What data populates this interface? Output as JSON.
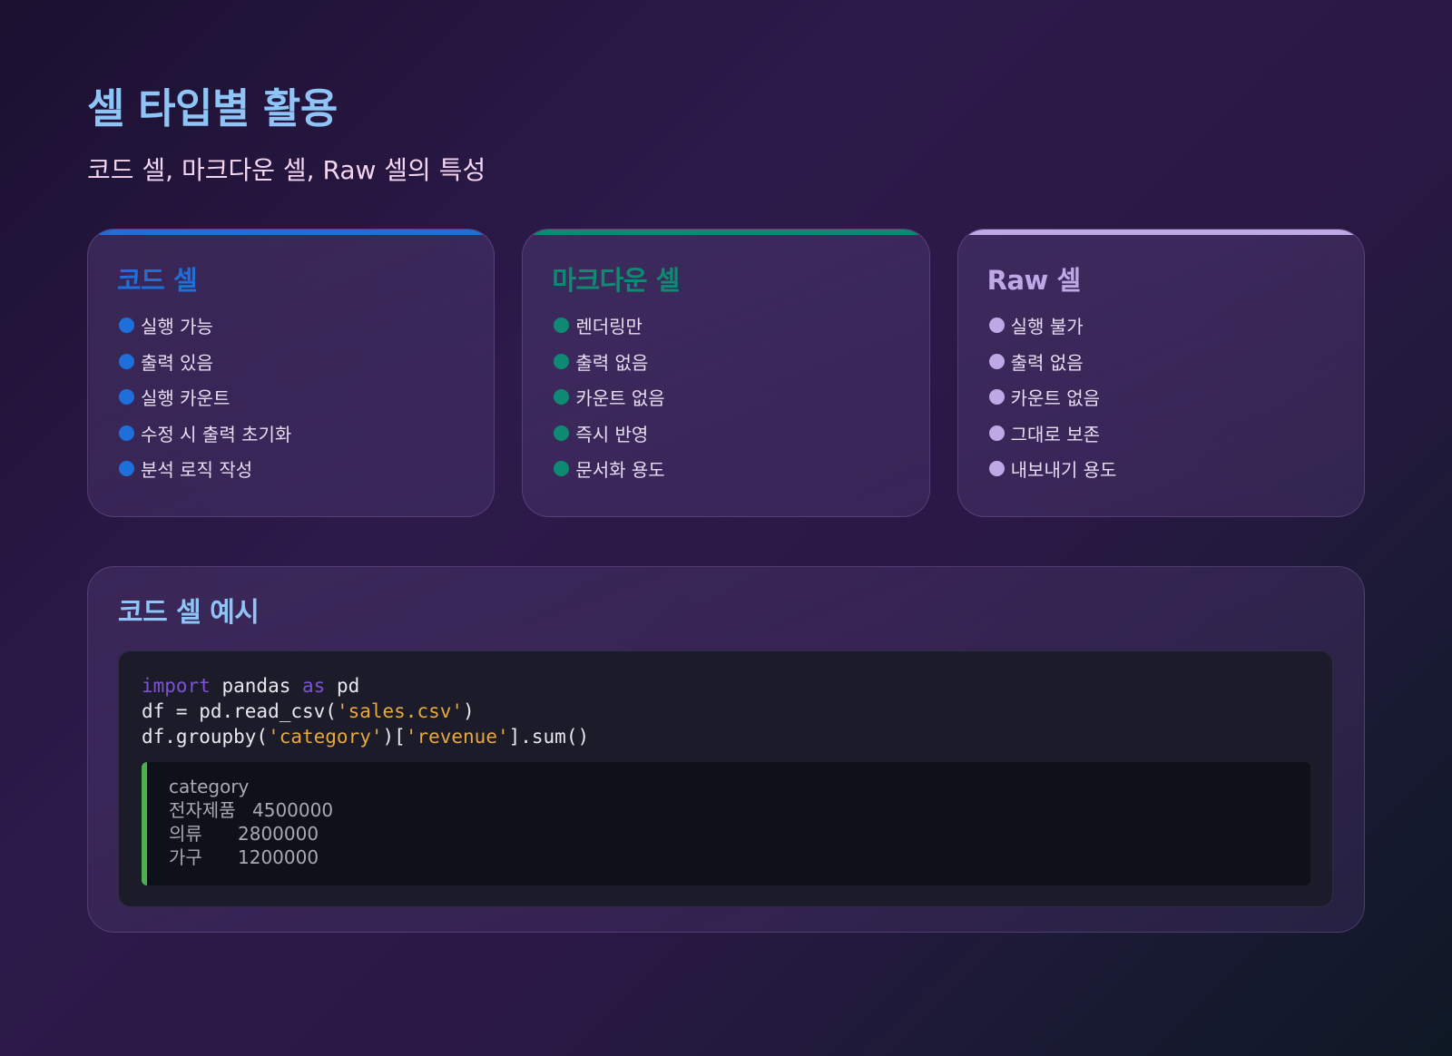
{
  "header": {
    "title": "셀 타입별 활용",
    "subtitle": "코드 셀, 마크다운 셀, Raw 셀의 특성"
  },
  "cards": [
    {
      "title": "코드 셀",
      "accent": "#1e6fd9",
      "items": [
        "실행 가능",
        "출력 있음",
        "실행 카운트",
        "수정 시 출력 초기화",
        "분석 로직 작성"
      ]
    },
    {
      "title": "마크다운 셀",
      "accent": "#0f8a72",
      "items": [
        "렌더링만",
        "출력 없음",
        "카운트 없음",
        "즉시 반영",
        "문서화 용도"
      ]
    },
    {
      "title": "Raw 셀",
      "accent": "#bfa8e6",
      "items": [
        "실행 불가",
        "출력 없음",
        "카운트 없음",
        "그대로 보존",
        "내보내기 용도"
      ]
    }
  ],
  "example": {
    "title": "코드 셀 예시",
    "code": {
      "line1": {
        "kw1": "import",
        "t1": " pandas ",
        "kw2": "as",
        "t2": " pd"
      },
      "line2": {
        "t1": "df = pd.read_csv(",
        "s1": "'sales.csv'",
        "t2": ")"
      },
      "line3": {
        "t1": "df.groupby(",
        "s1": "'category'",
        "t2": ")[",
        "s2": "'revenue'",
        "t3": "].sum()"
      }
    },
    "output": {
      "header": "category",
      "rows": [
        {
          "key": "전자제품",
          "value": "4500000"
        },
        {
          "key": "의류",
          "value": "2800000"
        },
        {
          "key": "가구",
          "value": "1200000"
        }
      ]
    }
  },
  "colors": {
    "title": "#8ec5f6",
    "keyword": "#7d52d6",
    "string": "#e6a93d",
    "output_border": "#4caf50"
  }
}
